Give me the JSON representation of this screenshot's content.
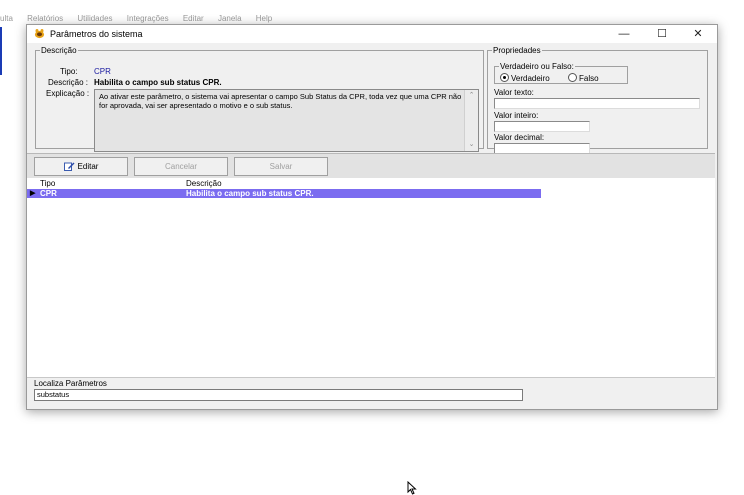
{
  "background_menu": [
    "ulta",
    "Relatórios",
    "Utilidades",
    "Integrações",
    "Editar",
    "Janela",
    "Help"
  ],
  "window": {
    "title": "Parâmetros do sistema",
    "controls": {
      "minimize": "—",
      "maximize": "☐",
      "close": "✕"
    }
  },
  "descricao": {
    "group_label": "Descrição",
    "tipo_label": "Tipo:",
    "tipo_value": "CPR",
    "descricao_label": "Descrição :",
    "descricao_value": "Habilita o campo sub status CPR.",
    "explicacao_label": "Explicação :",
    "explicacao_text": "Ao ativar este parâmetro, o sistema vai apresentar o campo Sub Status da CPR, toda vez que uma CPR não for aprovada, vai ser apresentado o motivo e o sub status."
  },
  "propriedades": {
    "group_label": "Propriedades",
    "vf_group_label": "Verdadeiro ou Falso:",
    "verdadeiro_label": "Verdadeiro",
    "falso_label": "Falso",
    "selected": "Verdadeiro",
    "valor_texto_label": "Valor texto:",
    "valor_texto": "",
    "valor_inteiro_label": "Valor inteiro:",
    "valor_inteiro": "",
    "valor_decimal_label": "Valor decimal:",
    "valor_decimal": ""
  },
  "toolbar": {
    "editar_label": "Editar",
    "cancelar_label": "Cancelar",
    "salvar_label": "Salvar"
  },
  "grid": {
    "columns": [
      "Tipo",
      "Descrição"
    ],
    "rows": [
      {
        "tipo": "CPR",
        "descricao": "Habilita o campo sub status CPR.",
        "selected": true
      }
    ]
  },
  "localiza": {
    "label": "Localiza Parâmetros",
    "value": "substatus"
  },
  "colors": {
    "selection": "#7b6cf0",
    "window_bg": "#f0f0f0",
    "tipo_value": "#1a1aa0"
  }
}
